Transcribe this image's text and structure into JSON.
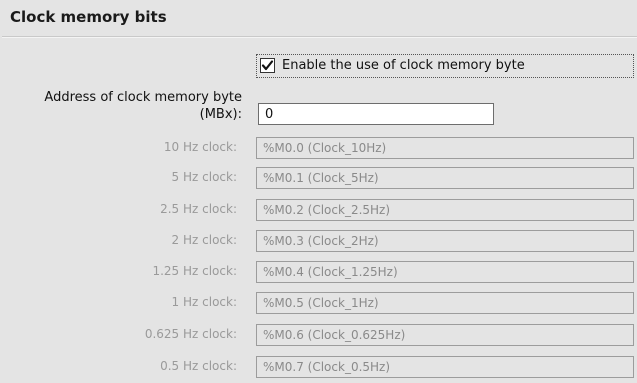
{
  "section": {
    "title": "Clock memory bits"
  },
  "enable_checkbox": {
    "label": "Enable the use of clock memory byte",
    "checked": true
  },
  "address": {
    "label_line1": "Address of clock memory byte",
    "label_line2": "(MBx):",
    "value": "0"
  },
  "clocks": [
    {
      "label": "10 Hz clock:",
      "value": "%M0.0 (Clock_10Hz)"
    },
    {
      "label": "5 Hz clock:",
      "value": "%M0.1 (Clock_5Hz)"
    },
    {
      "label": "2.5 Hz clock:",
      "value": "%M0.2 (Clock_2.5Hz)"
    },
    {
      "label": "2 Hz clock:",
      "value": "%M0.3 (Clock_2Hz)"
    },
    {
      "label": "1.25 Hz clock:",
      "value": "%M0.4 (Clock_1.25Hz)"
    },
    {
      "label": "1 Hz clock:",
      "value": "%M0.5 (Clock_1Hz)"
    },
    {
      "label": "0.625 Hz clock:",
      "value": "%M0.6 (Clock_0.625Hz)"
    },
    {
      "label": "0.5 Hz clock:",
      "value": "%M0.7 (Clock_0.5Hz)"
    }
  ]
}
